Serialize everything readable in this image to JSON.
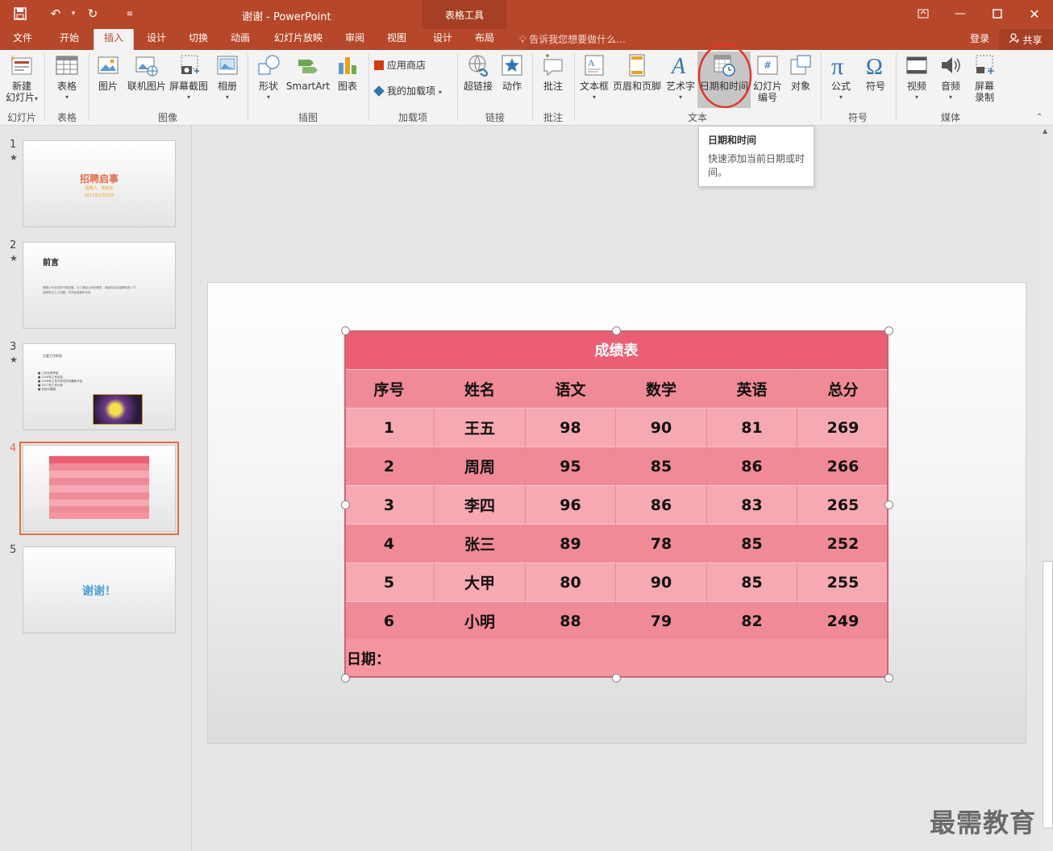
{
  "window": {
    "title": "谢谢 - PowerPoint",
    "context_tab_group": "表格工具"
  },
  "tabs": [
    "文件",
    "开始",
    "插入",
    "设计",
    "切换",
    "动画",
    "幻灯片放映",
    "审阅",
    "视图",
    "设计",
    "布局"
  ],
  "active_tab": "插入",
  "tell_me": "告诉我您想要做什么...",
  "account": {
    "login": "登录",
    "share": "共享"
  },
  "ribbon": {
    "buttons": {
      "new_slide": [
        "新建",
        "幻灯片"
      ],
      "table": "表格",
      "picture": "图片",
      "online_picture": "联机图片",
      "screenshot": "屏幕截图",
      "album": "相册",
      "shapes": "形状",
      "smartart": "SmartArt",
      "chart": "图表",
      "store": "应用商店",
      "my_addins": "我的加载项",
      "hyperlink": "超链接",
      "action": "动作",
      "comment": "批注",
      "textbox": "文本框",
      "header_footer": "页眉和页脚",
      "wordart": "艺术字",
      "date_time": "日期和时间",
      "slide_number": [
        "幻灯片",
        "编号"
      ],
      "object": "对象",
      "equation": "公式",
      "symbol": "符号",
      "video": "视频",
      "audio": "音频",
      "screen_record": [
        "屏幕",
        "录制"
      ]
    },
    "groups": {
      "slides": "幻灯片",
      "tables": "表格",
      "images": "图像",
      "illustrations": "插图",
      "addins": "加载项",
      "links": "链接",
      "comments": "批注",
      "text": "文本",
      "symbols": "符号",
      "media": "媒体"
    }
  },
  "tooltip": {
    "title": "日期和时间",
    "body_line1": "快速添加当前日期或时",
    "body_line2": "间。"
  },
  "slides": [
    {
      "num": "1",
      "star": "★",
      "title": "招聘启事",
      "subtitle": "招聘人：张宜欣",
      "date": "2017年1月10日"
    },
    {
      "num": "2",
      "star": "★",
      "title": "前言",
      "line1": "随着公司业务的不断发展，为了满足公司的需求，现面向社会招聘优秀人才",
      "line2": "诚邀有志之士加盟，共同创造美好未来"
    },
    {
      "num": "3",
      "star": "★",
      "title": "主要工作职责",
      "bullets": [
        "工作业绩考核",
        "2016年工作总结",
        "2016年工作中存在的问题和不足",
        "2017年工作计划",
        "总结与展望"
      ]
    },
    {
      "num": "4",
      "star": "",
      "selected": true
    },
    {
      "num": "5",
      "star": "",
      "title": "谢谢！"
    }
  ],
  "table": {
    "title": "成绩表",
    "headers": [
      "序号",
      "姓名",
      "语文",
      "数学",
      "英语",
      "总分"
    ],
    "rows": [
      [
        "1",
        "王五",
        "98",
        "90",
        "81",
        "269"
      ],
      [
        "2",
        "周周",
        "95",
        "85",
        "86",
        "266"
      ],
      [
        "3",
        "李四",
        "96",
        "86",
        "83",
        "265"
      ],
      [
        "4",
        "张三",
        "89",
        "78",
        "85",
        "252"
      ],
      [
        "5",
        "大甲",
        "80",
        "90",
        "85",
        "255"
      ],
      [
        "6",
        "小明",
        "88",
        "79",
        "82",
        "249"
      ]
    ],
    "date_label": "日期：",
    "colors": {
      "title_bg": "#ec5f73",
      "header_bg": "#f08a96",
      "row_light": "#f6a9b3",
      "row_dark": "#f08a96",
      "footer_bg": "#f6959f"
    }
  },
  "watermark": "最需教育",
  "accent": "#b7472a"
}
